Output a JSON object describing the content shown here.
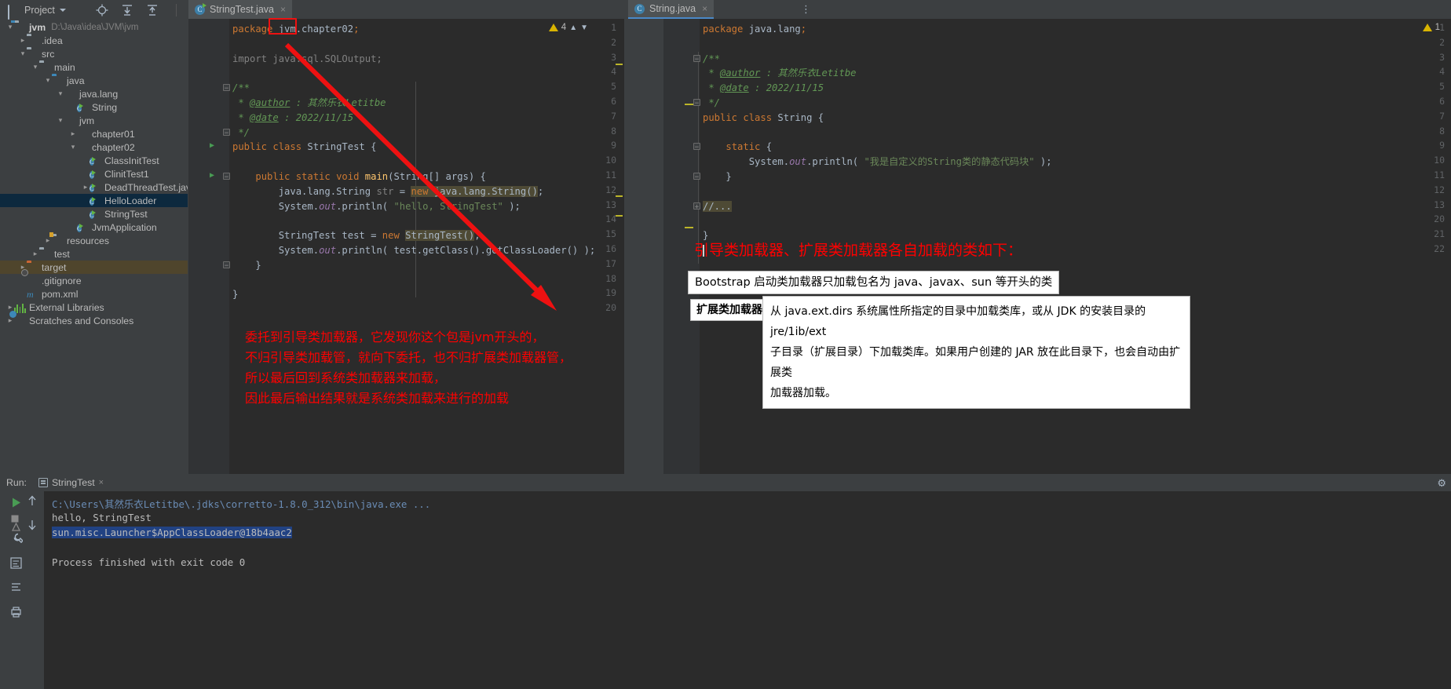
{
  "toolbar": {
    "project_label": "Project",
    "icons": [
      "locate-icon",
      "collapse-all-icon",
      "expand-all-icon",
      "settings-gear-icon",
      "minimize-icon"
    ]
  },
  "tabs": [
    {
      "label": "StringTest.java",
      "icon": "java-class-icon",
      "active": true,
      "close": "×"
    },
    {
      "label": "String.java",
      "icon": "java-class-icon",
      "active": true,
      "close": "×"
    }
  ],
  "tree": [
    {
      "indent": 0,
      "arrow": "open",
      "icon": "module-folder-icon",
      "label": "jvm",
      "bold": true,
      "path": "D:\\Java\\idea\\JVM\\jvm"
    },
    {
      "indent": 1,
      "arrow": "closed",
      "icon": "folder-icon",
      "label": ".idea"
    },
    {
      "indent": 1,
      "arrow": "open",
      "icon": "folder-icon",
      "label": "src"
    },
    {
      "indent": 2,
      "arrow": "open",
      "icon": "folder-icon",
      "label": "main"
    },
    {
      "indent": 3,
      "arrow": "open",
      "icon": "source-folder-icon",
      "label": "java"
    },
    {
      "indent": 4,
      "arrow": "open",
      "icon": "package-icon",
      "label": "java.lang"
    },
    {
      "indent": 5,
      "arrow": "none",
      "icon": "java-class-icon",
      "label": "String"
    },
    {
      "indent": 4,
      "arrow": "open",
      "icon": "package-icon",
      "label": "jvm"
    },
    {
      "indent": 5,
      "arrow": "closed",
      "icon": "package-icon",
      "label": "chapter01"
    },
    {
      "indent": 5,
      "arrow": "open",
      "icon": "package-icon",
      "label": "chapter02"
    },
    {
      "indent": 6,
      "arrow": "none",
      "icon": "java-class-icon",
      "label": "ClassInitTest"
    },
    {
      "indent": 6,
      "arrow": "none",
      "icon": "java-class-icon",
      "label": "ClinitTest1"
    },
    {
      "indent": 6,
      "arrow": "closed",
      "icon": "java-class-icon",
      "label": "DeadThreadTest.java"
    },
    {
      "indent": 6,
      "arrow": "none",
      "icon": "java-class-icon",
      "label": "HelloLoader",
      "selected": true
    },
    {
      "indent": 6,
      "arrow": "none",
      "icon": "java-class-icon",
      "label": "StringTest"
    },
    {
      "indent": 5,
      "arrow": "none",
      "icon": "spring-class-icon",
      "label": "JvmApplication"
    },
    {
      "indent": 3,
      "arrow": "closed",
      "icon": "resources-folder-icon",
      "label": "resources"
    },
    {
      "indent": 2,
      "arrow": "closed",
      "icon": "folder-icon",
      "label": "test"
    },
    {
      "indent": 1,
      "arrow": "closed",
      "icon": "target-folder-icon",
      "label": "target",
      "highlight": true
    },
    {
      "indent": 1,
      "arrow": "none",
      "icon": "gitignore-file-icon",
      "label": ".gitignore"
    },
    {
      "indent": 1,
      "arrow": "none",
      "icon": "maven-file-icon",
      "label": "pom.xml"
    },
    {
      "indent": 0,
      "arrow": "closed",
      "icon": "external-libraries-icon",
      "label": "External Libraries"
    },
    {
      "indent": 0,
      "arrow": "closed",
      "icon": "scratches-icon",
      "label": "Scratches and Consoles"
    }
  ],
  "editor_left": {
    "file": "StringTest.java",
    "inspection_count": "4",
    "lines": [
      {
        "n": 1,
        "html": "<span class='kw'>package</span> jvm.chapter02<span class='kw'>;</span>"
      },
      {
        "n": 2,
        "html": ""
      },
      {
        "n": 3,
        "html": "<span class='gray'>import java.sql.SQLOutput;</span>"
      },
      {
        "n": 4,
        "html": ""
      },
      {
        "n": 5,
        "html": "<span class='cmt'>/**</span>",
        "fold": "top"
      },
      {
        "n": 6,
        "html": "<span class='cmt'> * </span><span class='tag'>@author</span><span class='cmt'> : 其然乐衣Letitbe</span>"
      },
      {
        "n": 7,
        "html": "<span class='cmt'> * </span><span class='tag'>@date</span><span class='cmt'> : 2022/11/15</span>"
      },
      {
        "n": 8,
        "html": "<span class='cmt'> */</span>",
        "fold": "bottom"
      },
      {
        "n": 9,
        "html": "<span class='kw'>public class </span><span class='loc'>StringTest</span> {",
        "run": true
      },
      {
        "n": 10,
        "html": ""
      },
      {
        "n": 11,
        "html": "    <span class='kw'>public static void </span><span class='fn'>main</span>(<span class='loc'>String</span>[] args) {",
        "run": true,
        "fold": "top"
      },
      {
        "n": 12,
        "html": "        java.lang.String <span class='gray'>str</span> = <span class='ident-hl'><span class='kw'>new </span>java.lang.String()</span>;"
      },
      {
        "n": 13,
        "html": "        System.<span class='fld'>out</span>.println( <span class='str'>\"hello, StringTest\"</span> );"
      },
      {
        "n": 14,
        "html": ""
      },
      {
        "n": 15,
        "html": "        StringTest test = <span class='kw'>new </span><span class='ident-hl'>StringTest()</span>;"
      },
      {
        "n": 16,
        "html": "        System.<span class='fld'>out</span>.println( test.getClass().getClassLoader() );"
      },
      {
        "n": 17,
        "html": "    }",
        "fold": "bottom"
      },
      {
        "n": 18,
        "html": ""
      },
      {
        "n": 19,
        "html": "}"
      },
      {
        "n": 20,
        "html": ""
      }
    ]
  },
  "editor_right": {
    "file": "String.java",
    "inspection_count": "1",
    "lines": [
      {
        "n": 1,
        "html": "<span class='kw'>package </span>java.lang<span class='kw'>;</span>"
      },
      {
        "n": 2,
        "html": ""
      },
      {
        "n": 3,
        "html": "<span class='cmt'>/**</span>",
        "fold": "top"
      },
      {
        "n": 4,
        "html": "<span class='cmt'> * </span><span class='tag'>@author</span><span class='cmt'> : 其然乐衣Letitbe</span>"
      },
      {
        "n": 5,
        "html": "<span class='cmt'> * </span><span class='tag'>@date</span><span class='cmt'> : 2022/11/15</span>"
      },
      {
        "n": 6,
        "html": "<span class='cmt'> */</span>",
        "fold": "bottom"
      },
      {
        "n": 7,
        "html": "<span class='kw'>public class </span><span class='loc'>String</span> {"
      },
      {
        "n": 8,
        "html": ""
      },
      {
        "n": 9,
        "html": "    <span class='kw'>static </span>{",
        "fold": "top"
      },
      {
        "n": 10,
        "html": "        System.<span class='fld'>out</span>.println( <span class='str'>\"我是自定义的String类的静态代码块\"</span> );"
      },
      {
        "n": 11,
        "html": "    }",
        "fold": "bottom"
      },
      {
        "n": 12,
        "html": ""
      },
      {
        "n": 13,
        "html": "<span class='ident-hl'>//...</span>",
        "fold": "plus"
      },
      {
        "n": 20,
        "html": ""
      },
      {
        "n": 21,
        "html": "}"
      },
      {
        "n": 22,
        "html": "",
        "caret": true
      }
    ]
  },
  "annotations": {
    "headline": "引导类加载器、扩展类加载器各自加载的类如下：",
    "bootstrap_box": "Bootstrap 启动类加载器只加载包名为 java、javax、sun 等开头的类",
    "ext_label": "扩展类加载器",
    "ext_desc_line1": "从 java.ext.dirs 系统属性所指定的目录中加载类库，或从 JDK 的安装目录的 jre/1ib/ext",
    "ext_desc_line2": "子目录（扩展目录）下加载类库。如果用户创建的 JAR 放在此目录下，也会自动由扩展类",
    "ext_desc_line3": "加载器加载。",
    "note_line1": "委托到引导类加载器，它发现你这个包是jvm开头的，",
    "note_line2": "不归引导类加载管，就向下委托，也不归扩展类加载器管，",
    "note_line3": "所以最后回到系统类加载器来加载，",
    "note_line4": "因此最后输出结果就是系统类加载来进行的加载",
    "accent_red": "#ff0000"
  },
  "run_panel": {
    "title": "Run:",
    "tab_label": "StringTest",
    "tab_close": "×",
    "console": [
      {
        "text": "C:\\Users\\其然乐衣Letitbe\\.jdks\\corretto-1.8.0_312\\bin\\java.exe ...",
        "style": "path"
      },
      {
        "text": "hello, StringTest",
        "style": "normal"
      },
      {
        "text": "sun.misc.Launcher$AppClassLoader@18b4aac2",
        "style": "selected"
      },
      {
        "text": "",
        "style": "normal"
      },
      {
        "text": "Process finished with exit code 0",
        "style": "normal"
      }
    ],
    "side_icons": [
      "run-icon",
      "step-up-icon",
      "step-down-icon",
      "wrench-icon",
      "stop-icon",
      "soft-wrap-icon",
      "scroll-end-icon",
      "print-icon"
    ]
  }
}
